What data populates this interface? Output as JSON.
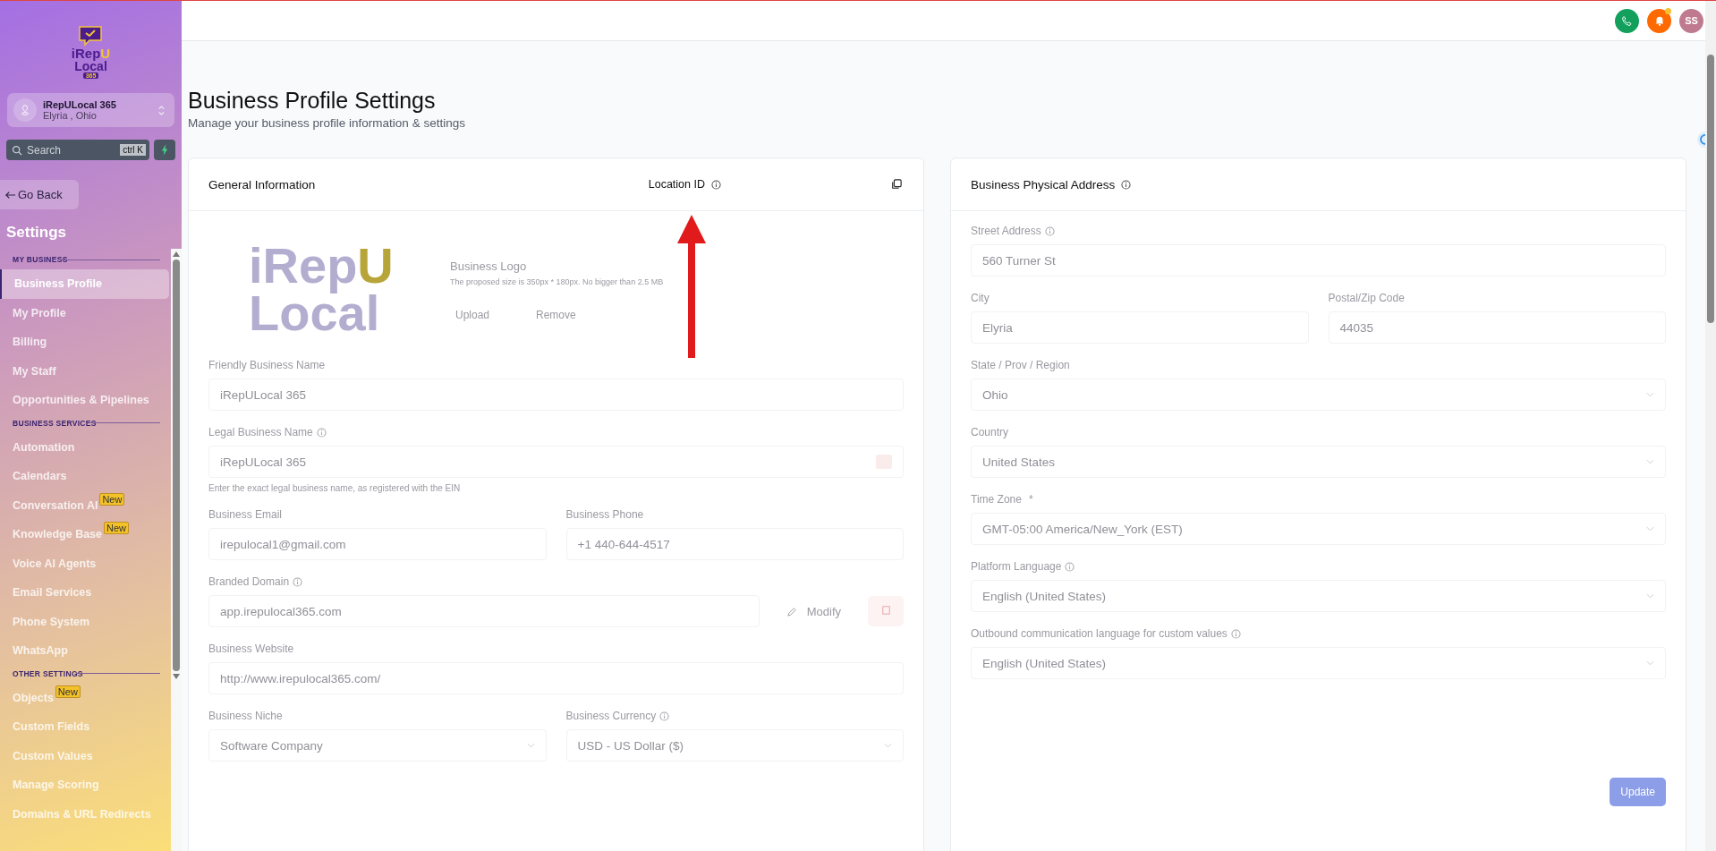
{
  "header": {
    "avatar_initials": "SS"
  },
  "sidebar": {
    "logo": {
      "prefix": "iRep",
      "highlight": "U",
      "line2": "Local",
      "badge": "365"
    },
    "account": {
      "name": "iRepULocal 365",
      "location": "Elyria , Ohio"
    },
    "search": {
      "placeholder": "Search",
      "shortcut": "ctrl K"
    },
    "back_button": "Go Back",
    "title": "Settings",
    "sections": [
      {
        "heading": "MY BUSINESS",
        "items": [
          {
            "label": "Business Profile",
            "selected": true
          },
          {
            "label": "My Profile",
            "selected": false
          },
          {
            "label": "Billing",
            "selected": false
          },
          {
            "label": "My Staff",
            "selected": false
          },
          {
            "label": "Opportunities & Pipelines",
            "selected": false
          }
        ]
      },
      {
        "heading": "BUSINESS SERVICES",
        "items": [
          {
            "label": "Automation",
            "selected": false
          },
          {
            "label": "Calendars",
            "selected": false
          },
          {
            "label": "Conversation AI",
            "selected": false,
            "badge": "New"
          },
          {
            "label": "Knowledge Base",
            "selected": false,
            "badge": "New"
          },
          {
            "label": "Voice AI Agents",
            "selected": false
          },
          {
            "label": "Email Services",
            "selected": false
          },
          {
            "label": "Phone System",
            "selected": false
          },
          {
            "label": "WhatsApp",
            "selected": false
          }
        ]
      },
      {
        "heading": "OTHER SETTINGS",
        "items": [
          {
            "label": "Objects",
            "selected": false,
            "badge": "New"
          },
          {
            "label": "Custom Fields",
            "selected": false
          },
          {
            "label": "Custom Values",
            "selected": false
          },
          {
            "label": "Manage Scoring",
            "selected": false
          },
          {
            "label": "Domains & URL Redirects",
            "selected": false
          }
        ]
      }
    ]
  },
  "page": {
    "title": "Business Profile Settings",
    "subtitle": "Manage your business profile information & settings"
  },
  "general_card": {
    "title": "General Information",
    "location_id_label": "Location ID",
    "logo_section": {
      "logo_prefix": "iRep",
      "logo_highlight": "U",
      "logo_line2": "Local",
      "title": "Business Logo",
      "hint": "The proposed size is 350px * 180px. No bigger than 2.5 MB",
      "upload": "Upload",
      "remove": "Remove"
    },
    "rows": [
      [
        {
          "label": "Friendly Business Name",
          "value": "iRepULocal 365",
          "info": false,
          "kind": "text"
        }
      ],
      [
        {
          "label": "Legal Business Name",
          "value": "iRepULocal 365",
          "info": true,
          "kind": "text",
          "hint": "Enter the exact legal business name, as registered with the EIN"
        }
      ],
      [
        {
          "label": "Business Email",
          "value": "irepulocal1@gmail.com",
          "info": false,
          "kind": "text"
        },
        {
          "label": "Business Phone",
          "value": "+1 440-644-4517",
          "info": false,
          "kind": "text"
        }
      ],
      [
        {
          "label": "Branded Domain",
          "value": "app.irepulocal365.com",
          "info": true,
          "kind": "domain",
          "action": "Modify"
        }
      ],
      [
        {
          "label": "Business Website",
          "value": "http://www.irepulocal365.com/",
          "info": false,
          "kind": "text"
        }
      ],
      [
        {
          "label": "Business Niche",
          "value": "Software Company",
          "info": false,
          "kind": "select"
        },
        {
          "label": "Business Currency",
          "value": "USD - US Dollar ($)",
          "info": true,
          "kind": "select"
        }
      ]
    ]
  },
  "address_card": {
    "title": "Business Physical Address",
    "rows": [
      [
        {
          "label": "Street Address",
          "value": "560 Turner St",
          "info": true,
          "kind": "text"
        }
      ],
      [
        {
          "label": "City",
          "value": "Elyria",
          "info": false,
          "kind": "text"
        },
        {
          "label": "Postal/Zip Code",
          "value": "44035",
          "info": false,
          "kind": "text"
        }
      ],
      [
        {
          "label": "State / Prov / Region",
          "value": "Ohio",
          "info": false,
          "kind": "select"
        }
      ],
      [
        {
          "label": "Country",
          "value": "United States",
          "info": false,
          "kind": "select"
        }
      ],
      [
        {
          "label": "Time Zone",
          "required": "*",
          "value": "GMT-05:00 America/New_York (EST)",
          "info": false,
          "kind": "select"
        }
      ],
      [
        {
          "label": "Platform Language",
          "value": "English (United States)",
          "info": true,
          "kind": "select"
        }
      ],
      [
        {
          "label": "Outbound communication language for custom values",
          "value": "English (United States)",
          "info": true,
          "kind": "select"
        }
      ]
    ],
    "update_button": "Update"
  }
}
